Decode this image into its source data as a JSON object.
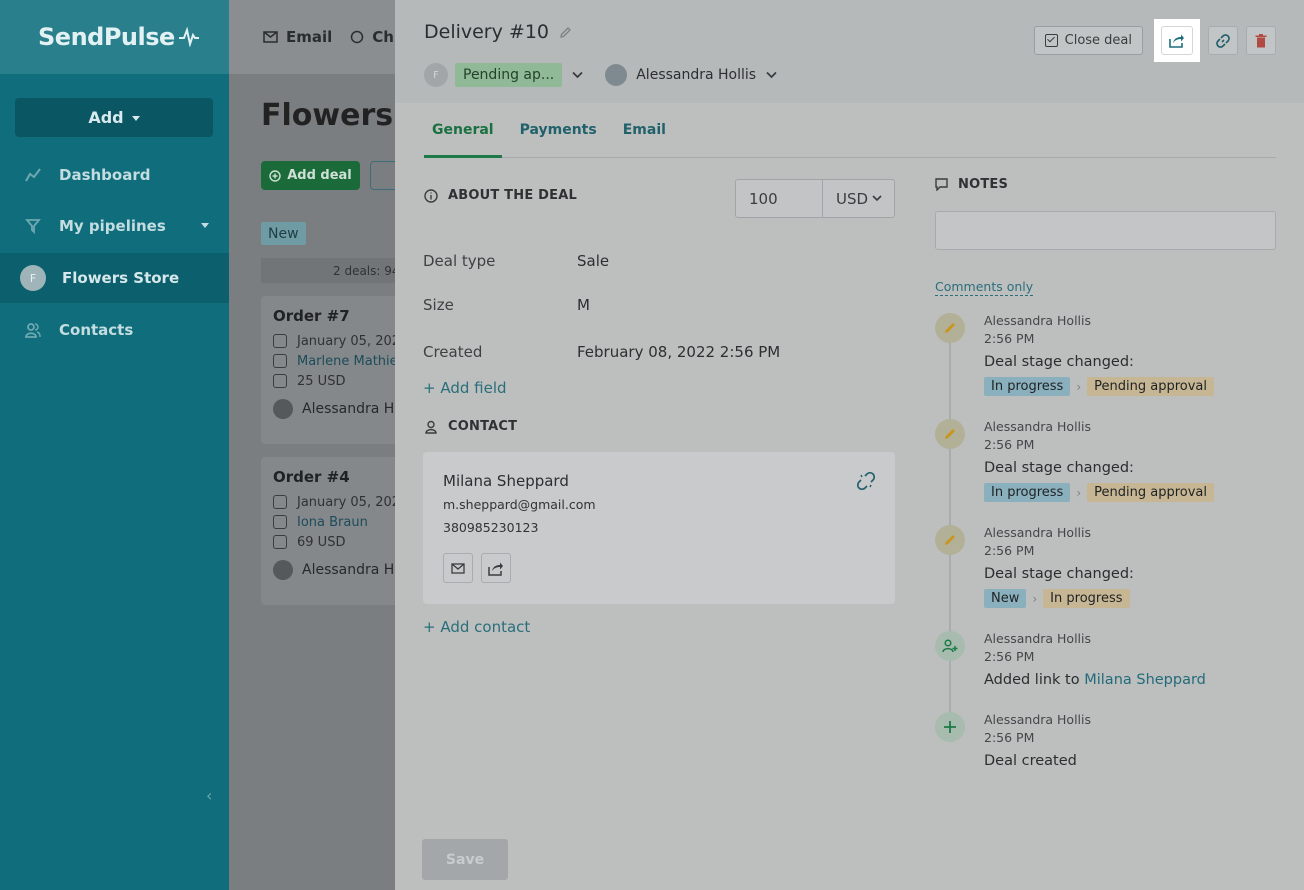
{
  "sidebar": {
    "logo": "SendPulse",
    "add_label": "Add",
    "items": [
      {
        "label": "Dashboard",
        "icon": "chart-line-icon"
      },
      {
        "label": "My pipelines",
        "icon": "funnel-icon"
      },
      {
        "label": "Flowers Store",
        "icon": "avatar",
        "avatar_letter": "F"
      },
      {
        "label": "Contacts",
        "icon": "users-icon"
      }
    ]
  },
  "main": {
    "topbar": {
      "email_label": "Email",
      "chat_label": "Ch"
    },
    "page_title": "Flowers S",
    "add_deal_label": "Add deal",
    "stage_label": "New",
    "deals_count": "2 deals: 94",
    "cards": [
      {
        "title": "Order #7",
        "date": "January 05, 202",
        "contact": "Marlene Mathieu",
        "amount": "25 USD",
        "owner": "Alessandra Ho"
      },
      {
        "title": "Order #4",
        "date": "January 05, 202",
        "contact": "Iona Braun",
        "amount": "69 USD",
        "owner": "Alessandra Ho"
      }
    ]
  },
  "deal": {
    "title": "Delivery #10",
    "stage_avatar": "F",
    "stage": "Pending ap...",
    "owner": "Alessandra Hollis",
    "close_deal_label": "Close deal",
    "tabs": [
      "General",
      "Payments",
      "Email"
    ],
    "about_heading": "ABOUT THE DEAL",
    "amount": "100",
    "currency": "USD",
    "fields": [
      {
        "label": "Deal type",
        "value": "Sale"
      },
      {
        "label": "Size",
        "value": "M"
      },
      {
        "label": "Created",
        "value": "February 08, 2022 2:56 PM"
      }
    ],
    "add_field_label": "+ Add field",
    "contact_heading": "CONTACT",
    "contact": {
      "name": "Milana Sheppard",
      "email": "m.sheppard@gmail.com",
      "phone": "380985230123"
    },
    "add_contact_label": "+ Add contact",
    "notes_heading": "NOTES",
    "notes_placeholder": "",
    "filter_label": "Comments only",
    "timeline": [
      {
        "author": "Alessandra Hollis",
        "time": "2:56 PM",
        "text": "Deal stage changed:",
        "from": "In progress",
        "to": "Pending approval",
        "icon": "pencil-icon"
      },
      {
        "author": "Alessandra Hollis",
        "time": "2:56 PM",
        "text": "Deal stage changed:",
        "from": "In progress",
        "to": "Pending approval",
        "icon": "pencil-icon"
      },
      {
        "author": "Alessandra Hollis",
        "time": "2:56 PM",
        "text": "Deal stage changed:",
        "from": "New",
        "to": "In progress",
        "icon": "pencil-icon"
      },
      {
        "author": "Alessandra Hollis",
        "time": "2:56 PM",
        "text_prefix": "Added link to ",
        "link": "Milana Sheppard",
        "icon": "add-user-icon"
      },
      {
        "author": "Alessandra Hollis",
        "time": "2:56 PM",
        "text": "Deal created",
        "icon": "plus-icon"
      }
    ],
    "save_label": "Save"
  },
  "colors": {
    "sidebar_bg": "#0f6d7c",
    "accent_green": "#1d7a48",
    "link": "#2a6e7a",
    "delete_red": "#c0392b"
  }
}
